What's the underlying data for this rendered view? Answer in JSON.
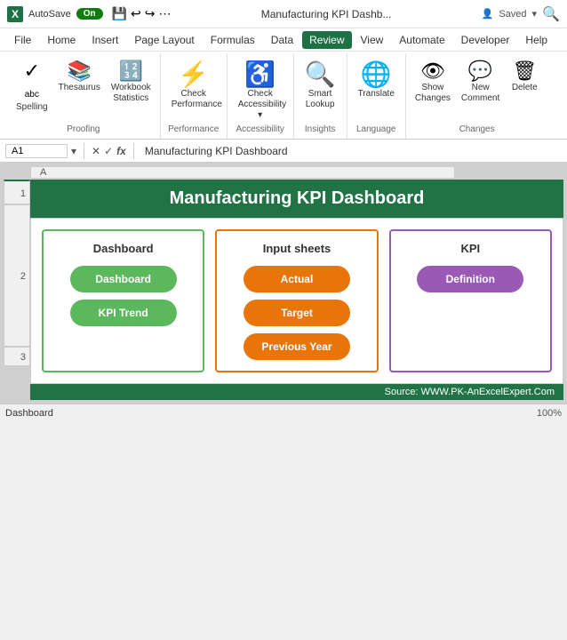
{
  "titlebar": {
    "logo": "X",
    "autosave": "AutoSave",
    "autosave_state": "On",
    "title": "Manufacturing KPI Dashb...",
    "saved": "Saved"
  },
  "menu": {
    "items": [
      "File",
      "Home",
      "Insert",
      "Page Layout",
      "Formulas",
      "Data",
      "Review",
      "View",
      "Automate",
      "Developer",
      "Help"
    ]
  },
  "ribbon": {
    "groups": [
      {
        "label": "Proofing",
        "buttons": [
          {
            "id": "spelling",
            "icon": "✓",
            "label": "Spelling"
          },
          {
            "id": "thesaurus",
            "icon": "📖",
            "label": "Thesaurus"
          },
          {
            "id": "workbook-stats",
            "icon": "123",
            "label": "Workbook Statistics"
          }
        ]
      },
      {
        "label": "Performance",
        "buttons": [
          {
            "id": "check-performance",
            "icon": "⚡",
            "label": "Check Performance"
          }
        ]
      },
      {
        "label": "Accessibility",
        "buttons": [
          {
            "id": "check-accessibility",
            "icon": "♿",
            "label": "Check Accessibility"
          }
        ]
      },
      {
        "label": "Insights",
        "buttons": [
          {
            "id": "smart-lookup",
            "icon": "🔍",
            "label": "Smart Lookup"
          }
        ]
      },
      {
        "label": "Language",
        "buttons": [
          {
            "id": "translate",
            "icon": "🌐",
            "label": "Translate"
          }
        ]
      },
      {
        "label": "Changes",
        "buttons": [
          {
            "id": "show-changes",
            "icon": "👁",
            "label": "Show Changes"
          },
          {
            "id": "new-comment",
            "icon": "💬",
            "label": "New Comment"
          },
          {
            "id": "delete",
            "icon": "🗑",
            "label": "Delete"
          }
        ]
      }
    ]
  },
  "formula_bar": {
    "cell_ref": "A1",
    "formula": "Manufacturing KPI Dashboard"
  },
  "sheet": {
    "title": "Manufacturing KPI Dashboard",
    "sections": [
      {
        "id": "dashboard",
        "title": "Dashboard",
        "color": "green",
        "buttons": [
          {
            "label": "Dashboard",
            "color": "green"
          },
          {
            "label": "KPI Trend",
            "color": "green"
          }
        ]
      },
      {
        "id": "input-sheets",
        "title": "Input sheets",
        "color": "orange",
        "buttons": [
          {
            "label": "Actual",
            "color": "orange"
          },
          {
            "label": "Target",
            "color": "orange"
          },
          {
            "label": "Previous Year",
            "color": "orange"
          }
        ]
      },
      {
        "id": "kpi",
        "title": "KPI",
        "color": "purple",
        "buttons": [
          {
            "label": "Definition",
            "color": "purple"
          }
        ]
      }
    ],
    "source": "Source: WWW.PK-AnExcelExpert.Com"
  }
}
